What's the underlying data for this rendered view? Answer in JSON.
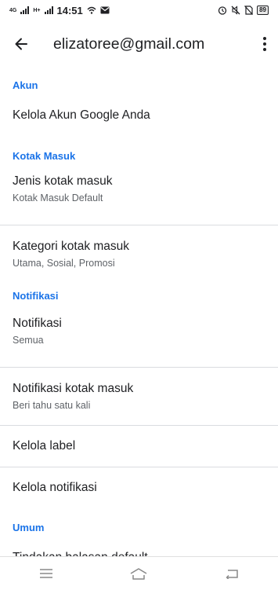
{
  "status_bar": {
    "net1": "4G",
    "net2": "H+",
    "time": "14:51",
    "battery": "89",
    "icons": [
      "signal-icon",
      "wifi-icon",
      "mail-icon",
      "alarm-icon",
      "mute-icon",
      "no-sim-icon",
      "battery-icon"
    ]
  },
  "app_bar": {
    "title": "elizatoree@gmail.com",
    "back_icon": "arrow-back-icon",
    "more_icon": "more-vert-icon"
  },
  "sections": {
    "account": {
      "header": "Akun",
      "manage": {
        "title": "Kelola Akun Google Anda"
      }
    },
    "inbox": {
      "header": "Kotak Masuk",
      "type": {
        "title": "Jenis kotak masuk",
        "subtitle": "Kotak Masuk Default"
      },
      "categories": {
        "title": "Kategori kotak masuk",
        "subtitle": "Utama, Sosial, Promosi"
      }
    },
    "notifications": {
      "header": "Notifikasi",
      "notif": {
        "title": "Notifikasi",
        "subtitle": "Semua"
      },
      "inbox_notif": {
        "title": "Notifikasi kotak masuk",
        "subtitle": "Beri tahu satu kali"
      },
      "labels": {
        "title": "Kelola label"
      },
      "manage_notif": {
        "title": "Kelola notifikasi"
      }
    },
    "general": {
      "header": "Umum",
      "default_reply": {
        "title": "Tindakan balasan default"
      }
    }
  },
  "nav_bar": {
    "icons": [
      "menu-icon",
      "home-icon",
      "back-icon"
    ]
  },
  "colors": {
    "accent": "#1a73e8",
    "text_primary": "#202124",
    "text_secondary": "#5f6368",
    "divider": "#dadce0"
  }
}
